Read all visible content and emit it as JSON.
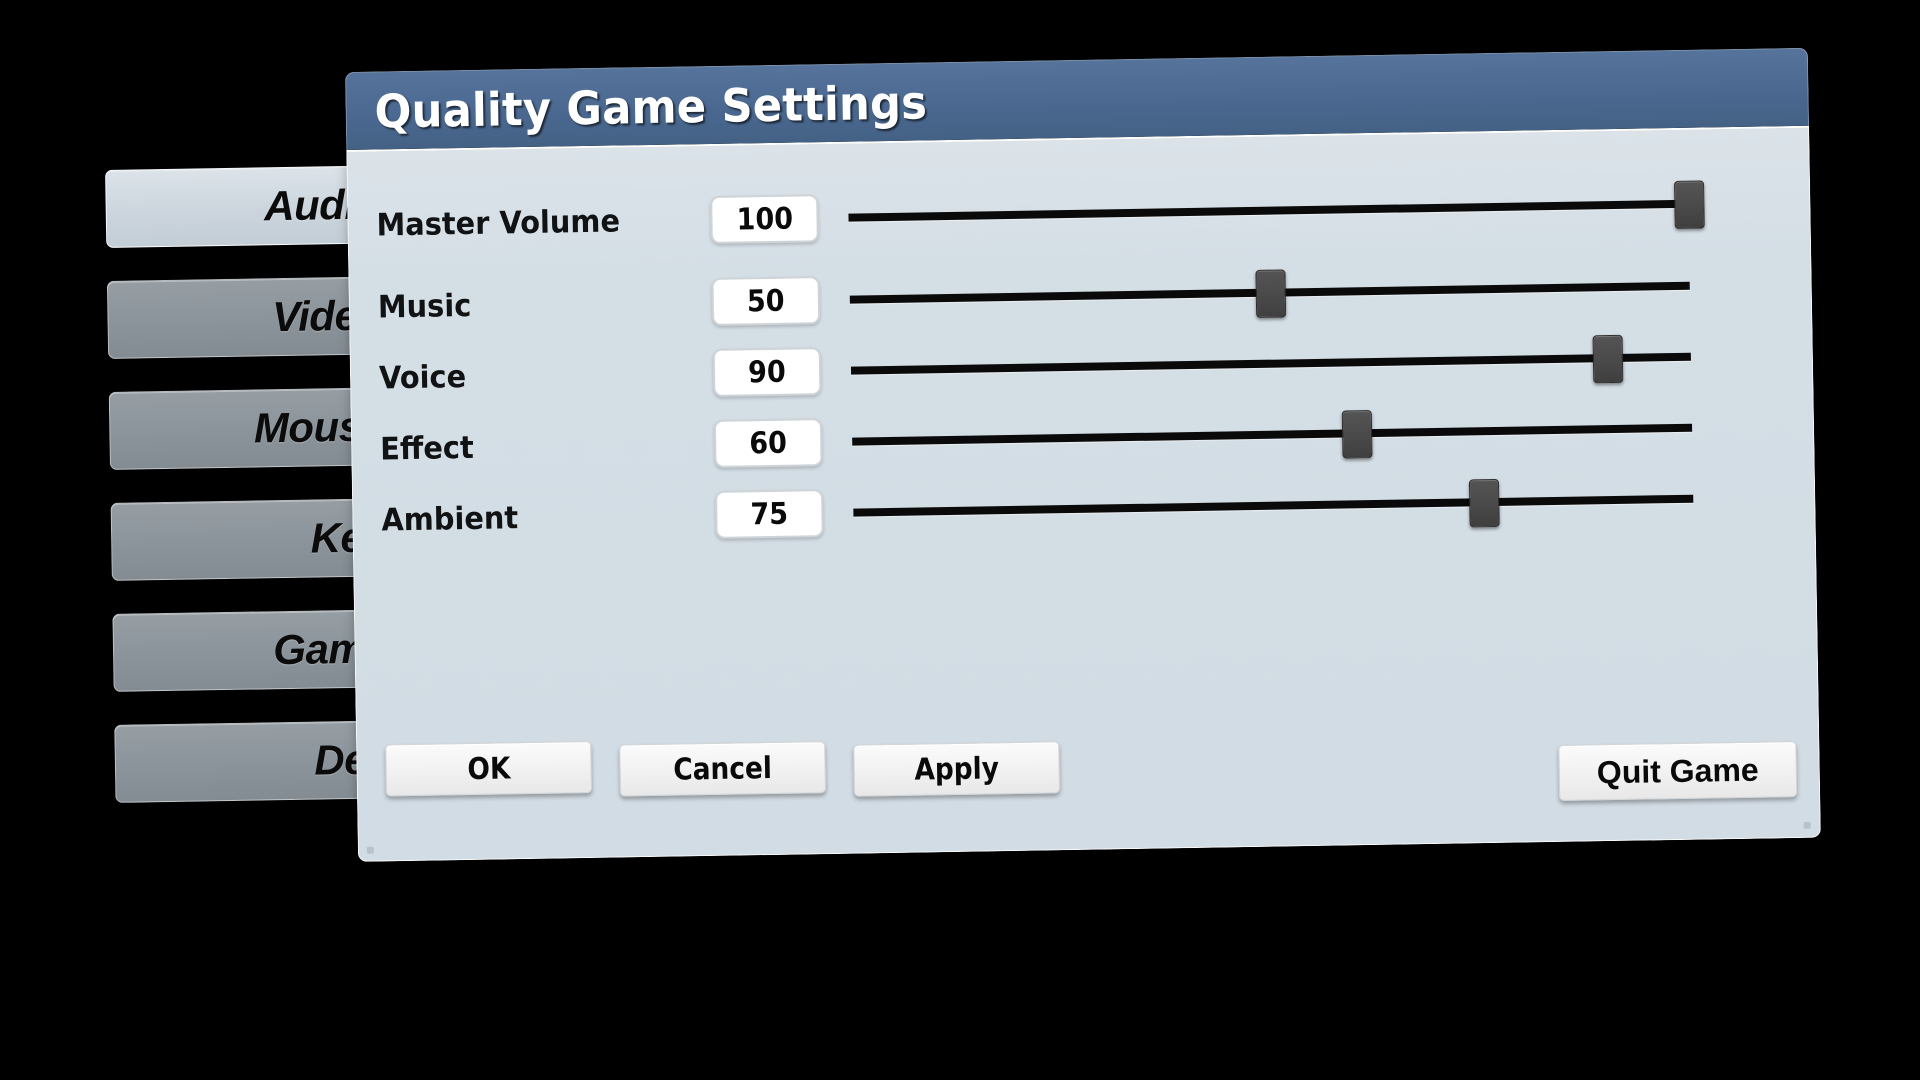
{
  "window": {
    "title": "Quality Game Settings",
    "title_bar_color": "#4a6890",
    "panel_color": "#d4dee5"
  },
  "sidebar": {
    "items": [
      {
        "label": "Audio",
        "active": true
      },
      {
        "label": "Video",
        "active": false
      },
      {
        "label": "Mouse",
        "active": false
      },
      {
        "label": "Key",
        "active": false
      },
      {
        "label": "Game",
        "active": false
      },
      {
        "label": "Dev",
        "active": false
      }
    ],
    "active_color": "#ccd5dd",
    "inactive_color": "#8b949a"
  },
  "settings": {
    "rows": [
      {
        "label": "Master Volume",
        "value": "100",
        "percent": 100
      },
      {
        "label": "Music",
        "value": "50",
        "percent": 50
      },
      {
        "label": "Voice",
        "value": "90",
        "percent": 90
      },
      {
        "label": "Effect",
        "value": "60",
        "percent": 60
      },
      {
        "label": "Ambient",
        "value": "75",
        "percent": 75
      }
    ],
    "slider_min": 0,
    "slider_max": 100,
    "handle_color": "#4a4a4a",
    "track_color": "#0a0a0a"
  },
  "buttons": {
    "ok": "OK",
    "cancel": "Cancel",
    "apply": "Apply",
    "quit": "Quit Game"
  }
}
